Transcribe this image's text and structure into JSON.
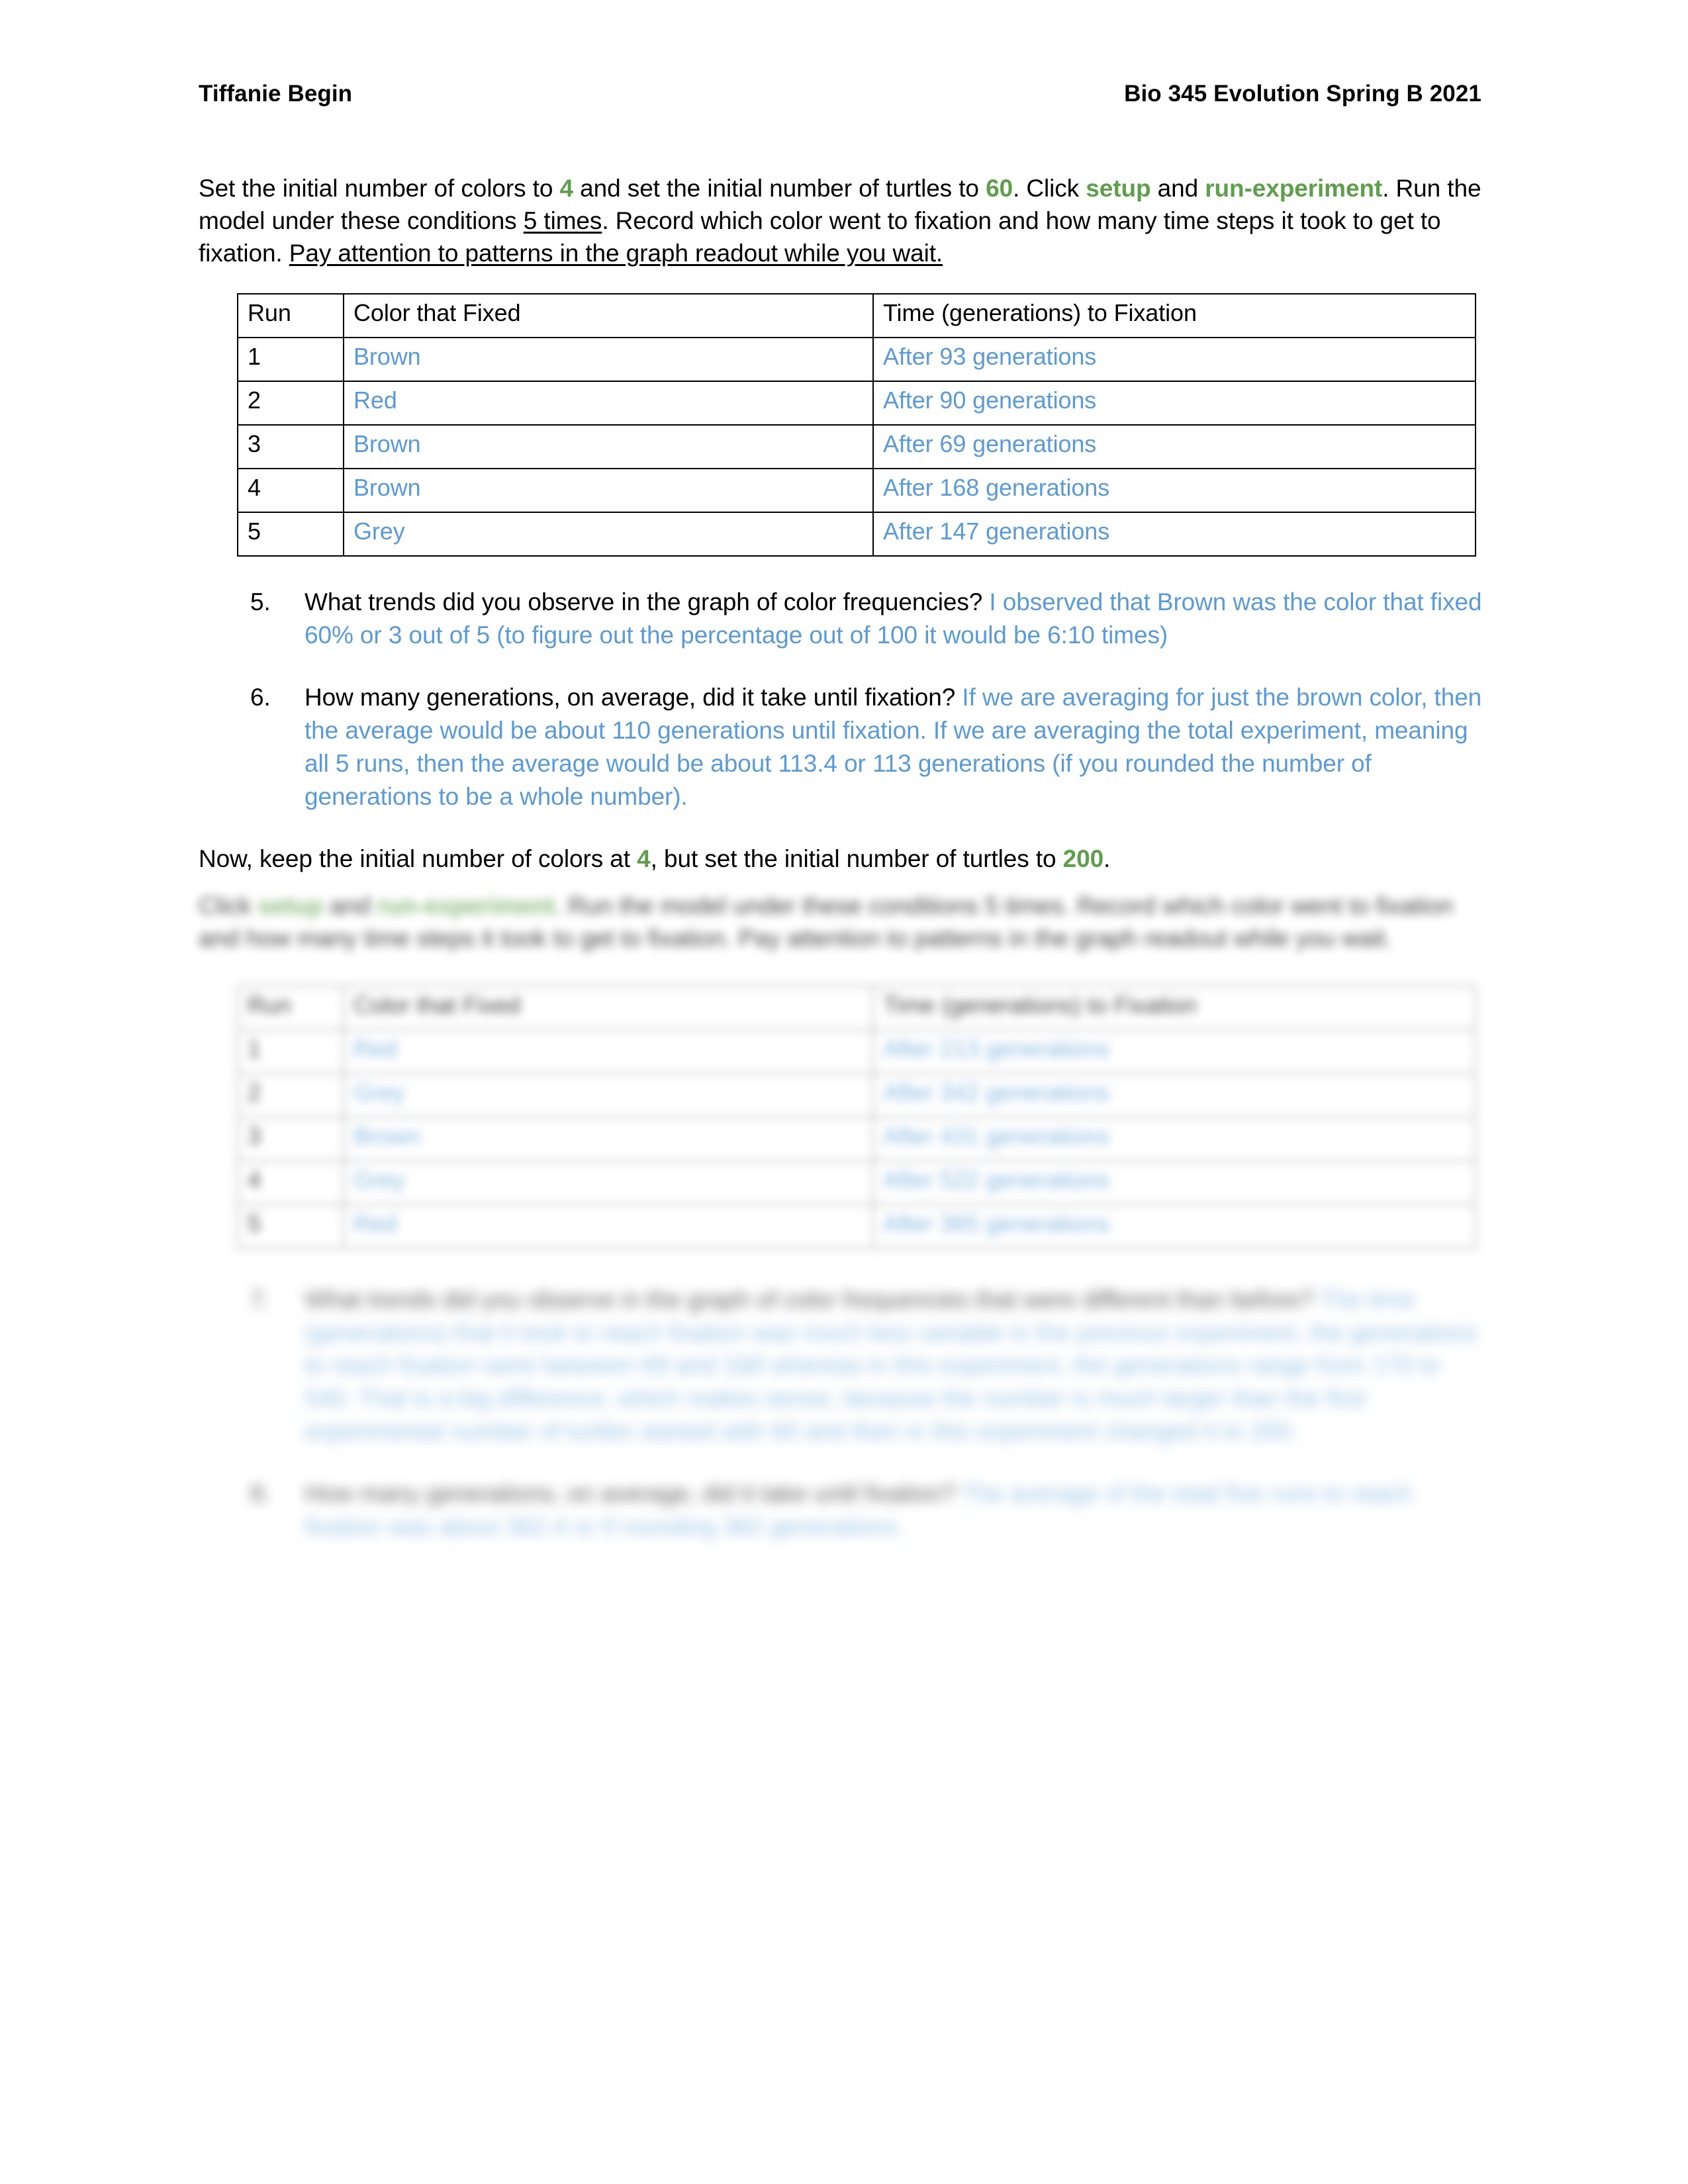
{
  "header": {
    "author": "Tiffanie Begin",
    "course": "Bio 345 Evolution Spring B 2021"
  },
  "intro_paragraph": {
    "seg1": "Set the initial number of colors to ",
    "colors_value": "4",
    "seg2": " and set the initial number of turtles to ",
    "turtles_value": "60",
    "seg3": ". Click ",
    "setup_label": "setup",
    "seg4": " and ",
    "run_label": "run-experiment",
    "seg5": ". Run the model under these conditions ",
    "times_underlined": "5 times",
    "seg6": ". Record which color went to fixation and how many time steps it took to get to fixation. ",
    "pay_attention_underlined": "Pay attention to patterns in the graph readout while you wait."
  },
  "table1": {
    "headers": [
      "Run",
      "Color that Fixed",
      "Time (generations) to Fixation"
    ],
    "rows": [
      {
        "run": "1",
        "color": "Brown",
        "time": "After 93 generations"
      },
      {
        "run": "2",
        "color": "Red",
        "time": "After 90 generations"
      },
      {
        "run": "3",
        "color": "Brown",
        "time": "After 69 generations"
      },
      {
        "run": "4",
        "color": "Brown",
        "time": "After 168 generations"
      },
      {
        "run": "5",
        "color": "Grey",
        "time": "After 147 generations"
      }
    ]
  },
  "questions": [
    {
      "num": "5.",
      "prompt": "What trends did you observe in the graph of color frequencies? ",
      "answer": "I observed that Brown was the color that fixed 60% or 3 out of 5 (to figure out the percentage out of 100 it would be 6:10 times)"
    },
    {
      "num": "6.",
      "prompt": "How many generations, on average, did it take until fixation? ",
      "answer": "If we are averaging for just the brown color, then the average would be about 110 generations until fixation. If we are averaging the total experiment, meaning all 5 runs, then the average would be about 113.4 or 113 generations (if you rounded the number of generations to be a whole number)."
    }
  ],
  "second_paragraph": {
    "seg1": "Now, keep the initial number of colors at ",
    "colors_value": "4",
    "seg2": ", but set the initial number of turtles to ",
    "turtles_value": "200",
    "seg3": "."
  },
  "blurred_section": {
    "instruction": {
      "seg1": "Click ",
      "setup_label": "setup",
      "seg2": " and ",
      "run_label": "run-experiment",
      "seg3": ". Run the model under these conditions 5 times. Record which color went to fixation and how many time steps it took to get to fixation. Pay attention to patterns in the graph readout while you wait."
    },
    "table2": {
      "headers": [
        "Run",
        "Color that Fixed",
        "Time (generations) to Fixation"
      ],
      "rows": [
        {
          "run": "1",
          "color": "Red",
          "time": "After 213 generations"
        },
        {
          "run": "2",
          "color": "Grey",
          "time": "After 342 generations"
        },
        {
          "run": "3",
          "color": "Brown",
          "time": "After 431 generations"
        },
        {
          "run": "4",
          "color": "Grey",
          "time": "After 522 generations"
        },
        {
          "run": "5",
          "color": "Red",
          "time": "After 365 generations"
        }
      ]
    },
    "questions": [
      {
        "num": "7.",
        "prompt": "What trends did you observe in the graph of color frequencies that were different than before? ",
        "answer": "The time (generations) that it took to reach fixation was much less variable in the previous experiment, the generations to reach fixation were between 69 and 168 whereas in this experiment, the generations range from 170 to 540. That is a big difference, which makes sense, because the number is much larger than the first experimental number of turtles started with 60 and then in this experiment changed it to 200."
      },
      {
        "num": "8.",
        "prompt": "How many generations, on average, did it take until fixation? ",
        "answer": "The average of the total five runs to reach fixation was about 362.4 or if rounding 362 generations."
      }
    ]
  },
  "colors": {
    "accent_blue": "#5B9BD5",
    "accent_green": "#5E9E4C",
    "text_black": "#000000"
  }
}
